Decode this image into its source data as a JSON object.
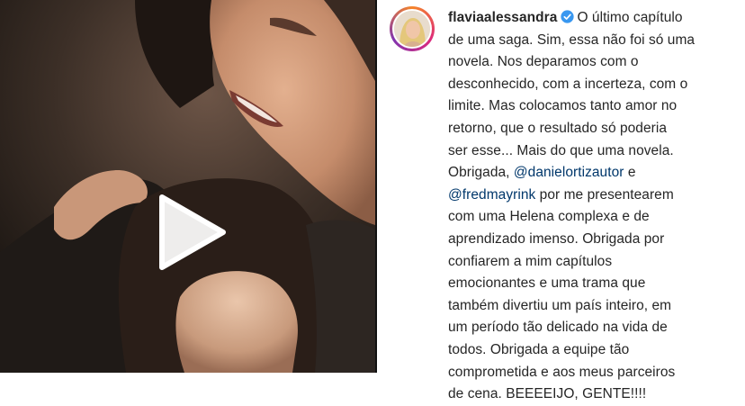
{
  "post": {
    "video": {
      "media": "video-still-two-women-embracing",
      "play_icon": "play-icon"
    },
    "author": {
      "username": "flaviaalessandra",
      "verified_icon": "verified-badge-icon",
      "avatar": "avatar"
    },
    "caption_lines": [
      "O último capítulo",
      "de uma saga. Sim, essa não foi só uma",
      "novela. Nos deparamos com o",
      "desconhecido, com a incerteza, com o",
      "limite. Mas colocamos tanto amor no",
      "retorno, que o resultado só poderia",
      "ser esse... Mais do que uma novela.",
      "Obrigada,",
      "e",
      "por me presentearem",
      "com uma Helena complexa e de",
      "aprendizado imenso. Obrigada por",
      "confiarem a mim capítulos",
      "emocionantes e uma trama que",
      "também divertiu um país inteiro, em",
      "um período tão delicado na vida de",
      "todos. Obrigada a equipe tão",
      "comprometida e aos meus parceiros",
      "de cena. BEEEEIJO, GENTE!!!!"
    ],
    "mentions": [
      "@danielortizautor",
      "@fredmayrink"
    ],
    "colors": {
      "mention": "#00376b",
      "verified": "#3897f0",
      "text": "#262626"
    }
  }
}
